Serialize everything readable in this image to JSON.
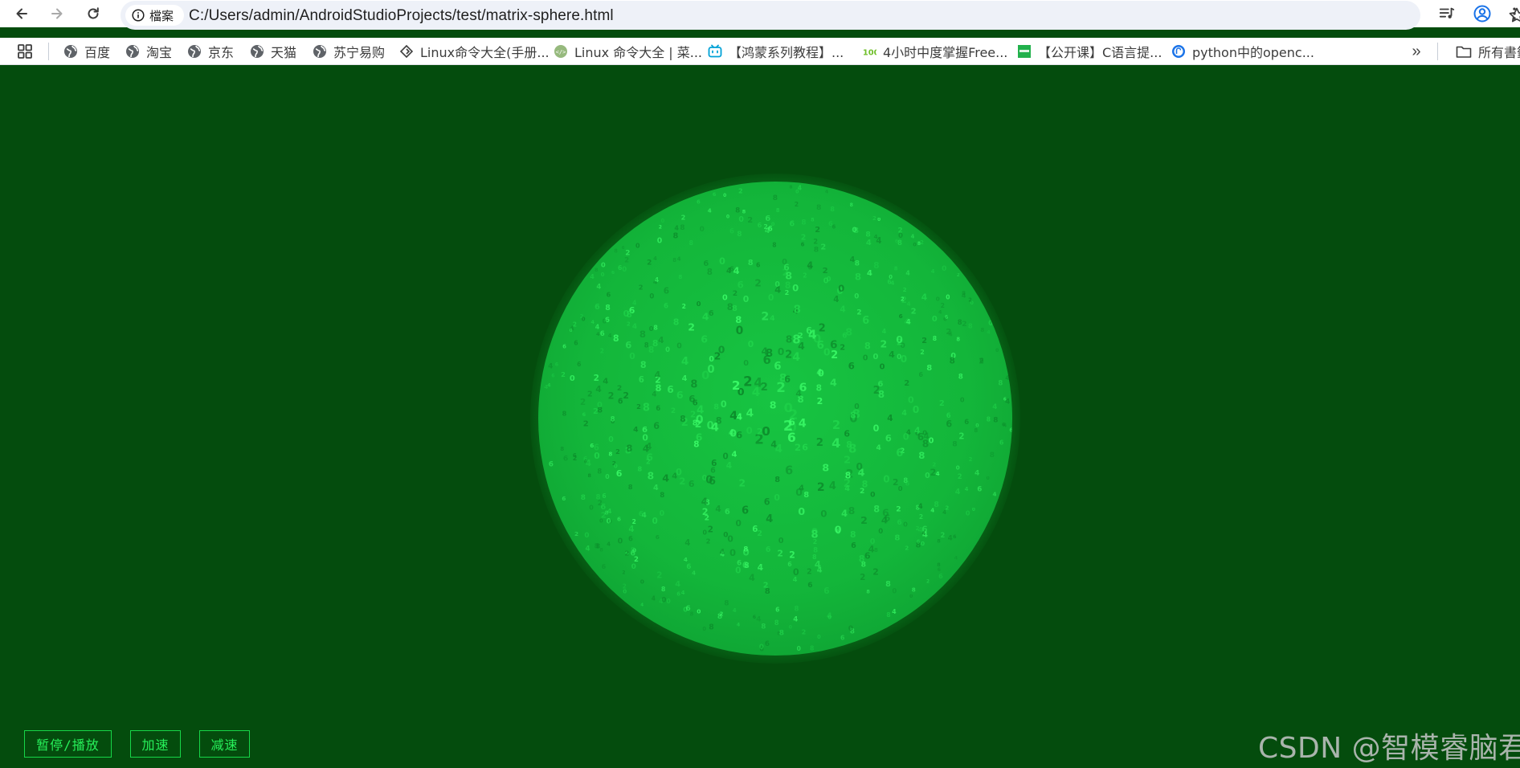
{
  "browser": {
    "site_chip_label": "檔案",
    "url": "C:/Users/admin/AndroidStudioProjects/test/matrix-sphere.html"
  },
  "bookmarks": {
    "items": [
      {
        "label": "百度",
        "icon": "globe-icon"
      },
      {
        "label": "淘宝",
        "icon": "globe-icon"
      },
      {
        "label": "京东",
        "icon": "globe-icon"
      },
      {
        "label": "天猫",
        "icon": "globe-icon"
      },
      {
        "label": "苏宁易购",
        "icon": "globe-icon"
      },
      {
        "label": "Linux命令大全(手册...",
        "icon": "linux-diamond-icon"
      },
      {
        "label": "Linux 命令大全 | 菜...",
        "icon": "runoob-icon"
      },
      {
        "label": "【鸿蒙系列教程】...",
        "icon": "bilibili-icon"
      },
      {
        "label": "4小时中度掌握Free...",
        "icon": "leaf-icon"
      },
      {
        "label": "【公开课】C语言提...",
        "icon": "green-square-icon"
      },
      {
        "label": "python中的openc...",
        "icon": "blue-circle-icon"
      }
    ],
    "all_bookmarks_label": "所有書籤"
  },
  "controls": {
    "pause_play": "暂停/播放",
    "speed_up": "加速",
    "slow_down": "减速"
  },
  "sphere": {
    "glyphs": [
      "0",
      "2",
      "4",
      "6",
      "8"
    ],
    "color": "#27e54f"
  },
  "watermark": "CSDN @智模睿脑君"
}
